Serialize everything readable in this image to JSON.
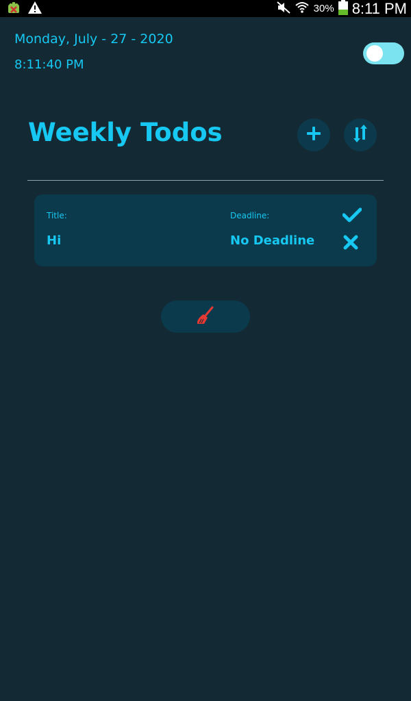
{
  "status_bar": {
    "battery": "30%",
    "time": "8:11 PM",
    "icons": [
      "android-debug-icon",
      "warning-icon",
      "mute-icon",
      "wifi-icon",
      "battery-icon"
    ]
  },
  "header": {
    "date": "Monday, July - 27 - 2020",
    "time": "8:11:40 PM",
    "toggle_on": true
  },
  "page": {
    "title": "Weekly Todos",
    "add_icon": "plus-icon",
    "sort_icon": "sort-icon"
  },
  "todos": [
    {
      "title_label": "Title:",
      "title": "Hi",
      "deadline_label": "Deadline:",
      "deadline": "No Deadline",
      "actions": [
        "check-icon",
        "close-icon"
      ]
    }
  ],
  "clear_button": {
    "icon": "broom-icon"
  },
  "colors": {
    "background": "#132933",
    "accent": "#16c8f2",
    "card": "#0b3a4c",
    "toggle": "#7be3ef",
    "broom": "#e53935"
  }
}
